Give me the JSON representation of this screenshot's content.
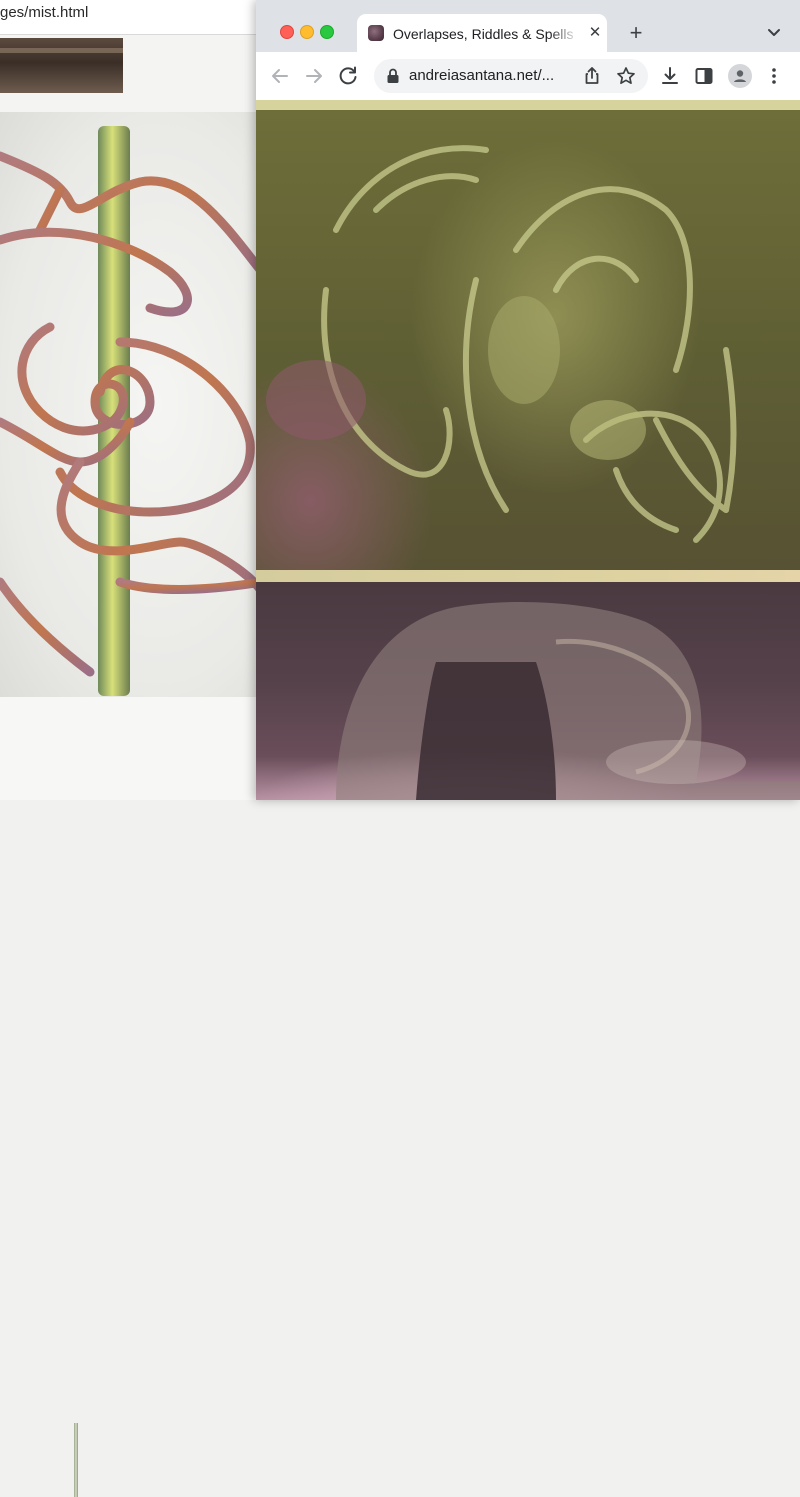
{
  "background_window": {
    "url_fragment": "ges/mist.html"
  },
  "browser": {
    "tab": {
      "title": "Overlapses, Riddles & Spells",
      "close_glyph": "✕"
    },
    "new_tab_glyph": "+",
    "address_bar": {
      "url": "andreiasantana.net/..."
    },
    "icons": {
      "back": "arrow-left-icon",
      "forward": "arrow-right-icon",
      "reload": "reload-icon",
      "lock": "lock-icon",
      "share": "share-icon",
      "bookmark": "star-icon",
      "download": "download-icon",
      "side_panel": "side-panel-icon",
      "profile": "profile-icon",
      "menu": "kebab-menu-icon",
      "tab_search": "chevron-down-icon"
    },
    "traffic_lights": {
      "close": "#fe5f57",
      "minimize": "#febc2e",
      "zoom": "#28c840"
    }
  },
  "colors": {
    "top_panel_tint": "#6e6e3a",
    "bottom_panel_tint": "#55414a",
    "divider": "#d6d39c"
  }
}
